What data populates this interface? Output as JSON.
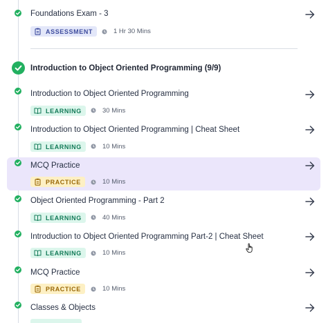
{
  "top_item": {
    "title": "Foundations Exam - 3",
    "badge": "ASSESSMENT",
    "badge_icon": "clipboard-icon",
    "duration": "1 Hr 30 Mins"
  },
  "section": {
    "title": "Introduction to Object Oriented Programming (9/9)",
    "status": "completed"
  },
  "items": [
    {
      "title": "Introduction to Object Oriented Programming",
      "badge": "LEARNING",
      "badge_type": "learning",
      "badge_icon": "book-icon",
      "duration": "30 Mins"
    },
    {
      "title": "Introduction to Object Oriented Programming | Cheat Sheet",
      "badge": "LEARNING",
      "badge_type": "learning",
      "badge_icon": "book-icon",
      "duration": "10 Mins"
    },
    {
      "title": "MCQ Practice",
      "badge": "PRACTICE",
      "badge_type": "practice",
      "badge_icon": "clipboard-icon",
      "duration": "10 Mins",
      "highlighted": true
    },
    {
      "title": "Object Oriented Programming - Part 2",
      "badge": "LEARNING",
      "badge_type": "learning",
      "badge_icon": "book-icon",
      "duration": "40 Mins"
    },
    {
      "title": "Introduction to Object Oriented Programming Part-2 | Cheat Sheet",
      "badge": "LEARNING",
      "badge_type": "learning",
      "badge_icon": "book-icon",
      "duration": "10 Mins"
    },
    {
      "title": "MCQ Practice",
      "badge": "PRACTICE",
      "badge_type": "practice",
      "badge_icon": "clipboard-icon",
      "duration": "10 Mins"
    },
    {
      "title": "Classes & Objects",
      "badge": "",
      "badge_type": "learning",
      "badge_icon": "book-icon",
      "duration": ""
    }
  ],
  "colors": {
    "check_green": "#22b060",
    "highlight": "#ebe6fb",
    "learning_bg": "#dcf6ec",
    "learning_text": "#127a57",
    "practice_bg": "#fdf0c4",
    "practice_text": "#9a6808",
    "assessment_bg": "#e3e7f9",
    "assessment_text": "#3e4c9e"
  }
}
